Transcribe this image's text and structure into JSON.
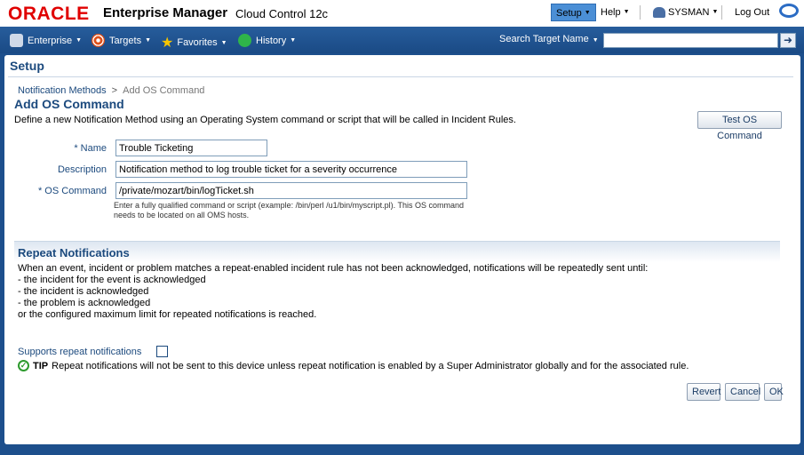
{
  "brand": {
    "logo": "ORACLE",
    "product": "Enterprise Manager",
    "edition": "Cloud Control 12c"
  },
  "global_links": {
    "setup": "Setup",
    "help": "Help",
    "user": "SYSMAN",
    "logout": "Log Out"
  },
  "nav": {
    "items": [
      {
        "label": "Enterprise",
        "icon": "enterprise-icon"
      },
      {
        "label": "Targets",
        "icon": "target-icon"
      },
      {
        "label": "Favorites",
        "icon": "star-icon"
      },
      {
        "label": "History",
        "icon": "history-icon"
      }
    ],
    "search_label": "Search Target Name",
    "search_value": ""
  },
  "page": {
    "title": "Setup",
    "breadcrumb": {
      "parent": "Notification Methods",
      "separator": ">",
      "current": "Add OS Command"
    },
    "heading": "Add OS Command",
    "description": "Define a new Notification Method using an Operating System command or script that will be called in Incident Rules.",
    "test_button": "Test OS Command"
  },
  "form": {
    "required_marker": "*",
    "name_label": "Name",
    "name_value": "Trouble Ticketing",
    "description_label": "Description",
    "description_value": "Notification method to log trouble ticket for a severity occurrence",
    "command_label": "OS Command",
    "command_value": "/private/mozart/bin/logTicket.sh",
    "command_hint": "Enter a fully qualified command or script (example: /bin/perl /u1/bin/myscript.pl). This OS command needs to be located on all OMS hosts."
  },
  "repeat": {
    "title": "Repeat Notifications",
    "lines": [
      "When an event, incident or problem matches a repeat-enabled incident rule has not been acknowledged, notifications will be repeatedly sent until:",
      "- the incident for the event is acknowledged",
      "- the incident is acknowledged",
      "- the problem is acknowledged",
      "or the configured maximum limit for repeated notifications is reached."
    ],
    "supports_label": "Supports repeat notifications",
    "supports_checked": false,
    "tip_label": "TIP",
    "tip_text": "Repeat notifications will not be sent to this device unless repeat notification is enabled by a Super Administrator globally and for the associated rule."
  },
  "actions": {
    "revert": "Revert",
    "cancel": "Cancel",
    "ok": "OK"
  },
  "colors": {
    "nav_bg": "#1d4f8c",
    "brand_red": "#e00000",
    "link_blue": "#1c4a7e"
  }
}
